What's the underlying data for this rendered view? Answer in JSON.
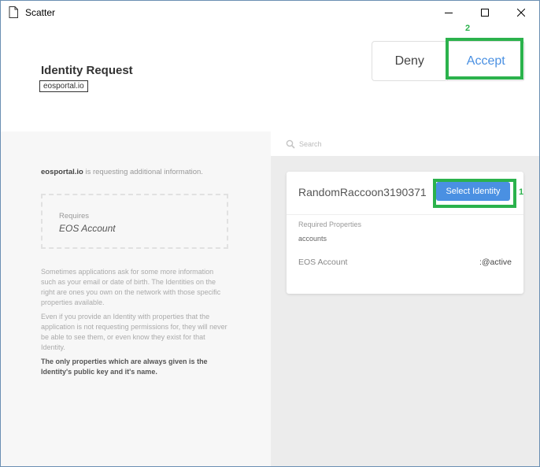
{
  "window": {
    "title": "Scatter",
    "controls": [
      "minimize",
      "maximize",
      "close"
    ]
  },
  "header": {
    "title": "Identity Request",
    "origin": "eosportal.io",
    "deny_label": "Deny",
    "accept_label": "Accept"
  },
  "annotations": {
    "accept_marker": "2",
    "select_marker": "1",
    "highlight_color": "#2bb24c"
  },
  "left": {
    "origin": "eosportal.io",
    "requesting_text": " is requesting additional information.",
    "requires_label": "Requires",
    "requires_value": "EOS Account",
    "paragraph1": "Sometimes applications ask for some more information such as your email or date of birth. The Identities on the right are ones you own on the network with those specific properties available.",
    "paragraph2": "Even if you provide an Identity with properties that the application is not requesting permissions for, they will never be able to see them, or even know they exist for that Identity.",
    "paragraph3": "The only properties which are always given is the Identity's public key and it's name."
  },
  "right": {
    "search_placeholder": "Search",
    "identity": {
      "name": "RandomRaccoon3190371",
      "select_label": "Select Identity",
      "required_properties_label": "Required Properties",
      "required_properties_value": "accounts",
      "account_label": "EOS Account",
      "account_value": ":@active"
    }
  },
  "colors": {
    "accent": "#4a90e2",
    "left_pane_bg": "#f7f7f7",
    "right_pane_bg": "#ececec"
  }
}
